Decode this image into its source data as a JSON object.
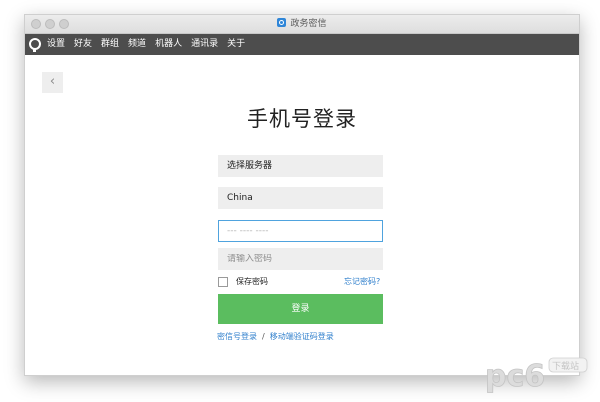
{
  "window": {
    "title": "政务密信"
  },
  "menu": {
    "items": [
      {
        "label": "设置"
      },
      {
        "label": "好友"
      },
      {
        "label": "群组"
      },
      {
        "label": "频道"
      },
      {
        "label": "机器人"
      },
      {
        "label": "通讯录"
      },
      {
        "label": "关于"
      }
    ]
  },
  "back": {
    "label": "‹"
  },
  "page": {
    "title": "手机号登录"
  },
  "form": {
    "server_label": "选择服务器",
    "country_value": "China",
    "phone_placeholder": "--- ---- ----",
    "password_placeholder": "请输入密码",
    "remember_label": "保存密码",
    "forgot_label": "忘记密码?",
    "login_label": "登录"
  },
  "alt_login": {
    "option1": "密信号登录",
    "separator": "/",
    "option2": "移动端验证码登录"
  },
  "watermark": {
    "text": "pc6",
    "sub": "下载站"
  },
  "colors": {
    "menubar": "#4d4d4d",
    "login_button": "#5bbd5f",
    "link": "#2f7fcc",
    "focus_border": "#4fa3de"
  }
}
